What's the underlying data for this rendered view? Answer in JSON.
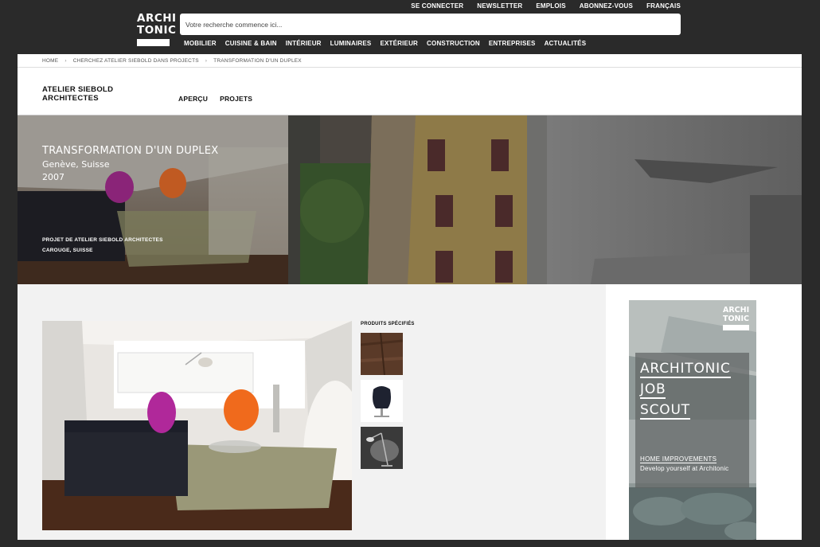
{
  "header": {
    "logo_line1": "ARCHI",
    "logo_line2": "TONIC",
    "top_links": [
      "SE CONNECTER",
      "NEWSLETTER",
      "EMPLOIS",
      "ABONNEZ-VOUS",
      "FRANÇAIS"
    ],
    "search_placeholder": "Votre recherche commence ici...",
    "nav": [
      "MOBILIER",
      "CUISINE & BAIN",
      "INTÉRIEUR",
      "LUMINAIRES",
      "EXTÉRIEUR",
      "CONSTRUCTION",
      "ENTREPRISES",
      "ACTUALITÉS"
    ]
  },
  "breadcrumb": [
    "HOME",
    "CHERCHEZ ATELIER SIEBOLD DANS PROJECTS",
    "TRANSFORMATION D'UN DUPLEX"
  ],
  "firm": {
    "name_line1": "ATELIER SIEBOLD",
    "name_line2": "ARCHITECTES",
    "tabs": [
      "APERÇU",
      "PROJETS"
    ]
  },
  "hero": {
    "title": "TRANSFORMATION D'UN DUPLEX",
    "location": "Genève, Suisse",
    "year": "2007",
    "credit_line1": "PROJET DE ATELIER SIEBOLD ARCHITECTES",
    "credit_line2": "CAROUGE, SUISSE"
  },
  "products": {
    "label": "PRODUITS SPÉCIFIÉS",
    "thumbnails": [
      "wood-floor-sample",
      "egg-chair",
      "floor-lamp"
    ]
  },
  "ad": {
    "logo_line1": "ARCHI",
    "logo_line2": "TONIC",
    "line1": "ARCHITONIC",
    "line2": "JOB",
    "line3": "SCOUT",
    "sub1": "HOME IMPROVEMENTS",
    "sub2": "Develop yourself at Architonic"
  },
  "colors": {
    "page_bg": "#2a2a2a",
    "content_bg": "#f2f2f2",
    "chair_magenta": "#b0289a",
    "chair_orange": "#f06a1c",
    "facade_yellow": "#d8b34a"
  }
}
